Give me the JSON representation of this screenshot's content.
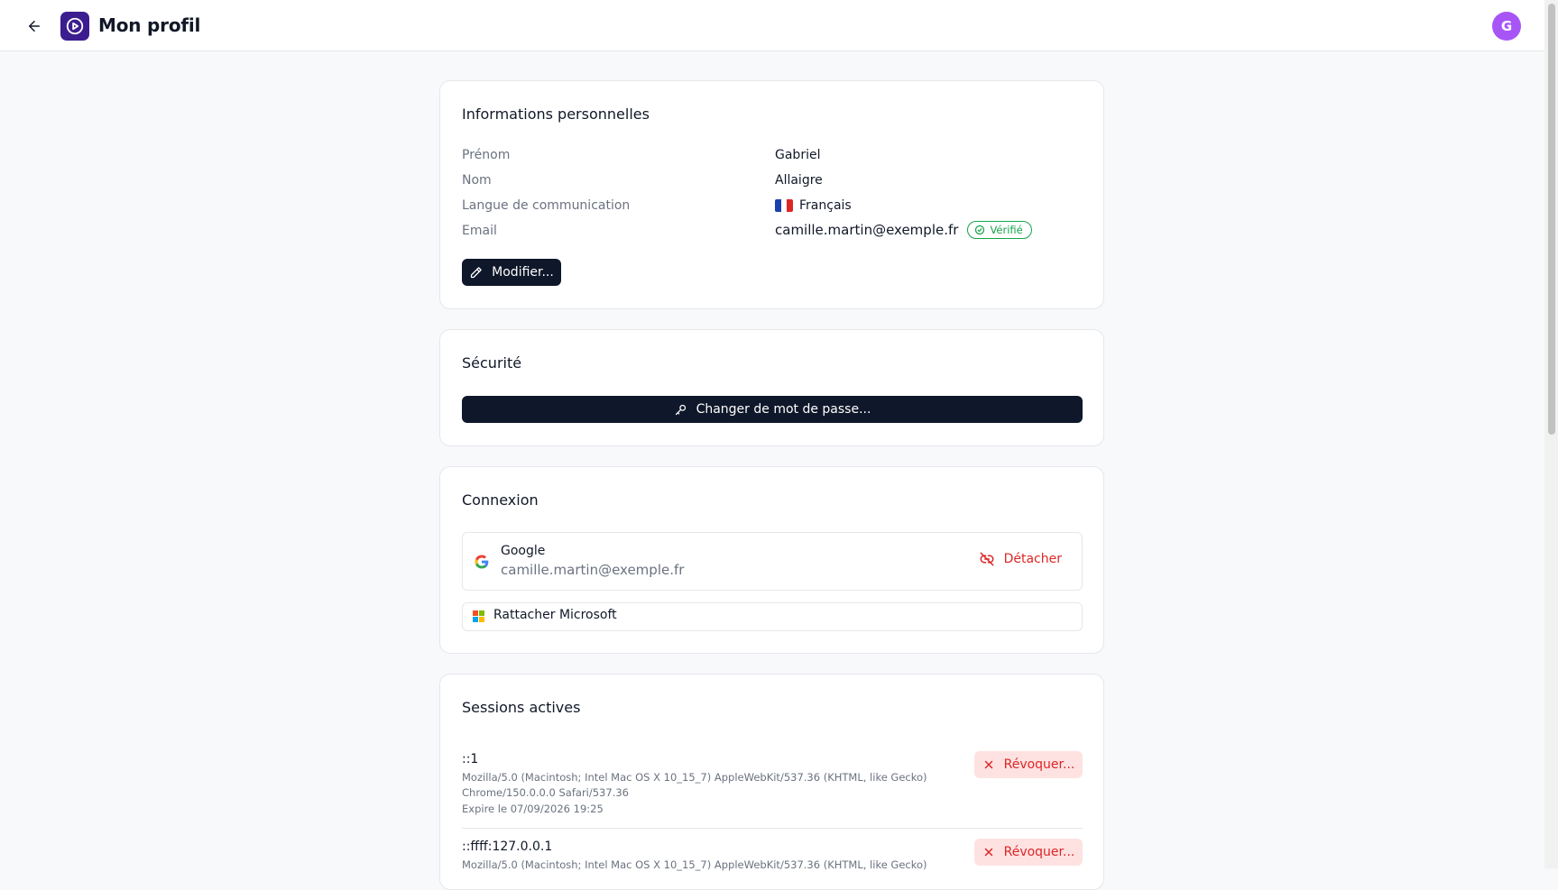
{
  "header": {
    "title": "Mon profil",
    "avatar_initial": "G",
    "back_icon": "arrow-left-icon",
    "logo_icon": "play-circle-icon",
    "logo_color": "#3b1d8f",
    "avatar_color": "#a855f7"
  },
  "personal": {
    "title": "Informations personnelles",
    "fields": [
      {
        "label": "Prénom",
        "value": "Gabriel"
      },
      {
        "label": "Nom",
        "value": "Allaigre"
      },
      {
        "label": "Langue de communication",
        "value": "Français"
      },
      {
        "label": "Email",
        "value": "camille.martin@exemple.fr"
      }
    ],
    "verified_label": "Vérifié",
    "edit_label": "Modifier..."
  },
  "security": {
    "title": "Sécurité",
    "change_password_label": "Changer de mot de passe..."
  },
  "connection": {
    "title": "Connexion",
    "google": {
      "name": "Google",
      "email": "camille.martin@exemple.fr",
      "detach_label": "Détacher"
    },
    "microsoft": {
      "label": "Rattacher Microsoft"
    }
  },
  "sessions": {
    "title": "Sessions actives",
    "items": [
      {
        "ip": "::1",
        "user_agent": "Mozilla/5.0 (Macintosh; Intel Mac OS X 10_15_7) AppleWebKit/537.36 (KHTML, like Gecko) Chrome/150.0.0.0 Safari/537.36",
        "expires": "Expire le 07/09/2026 19:25",
        "revoke_label": "Révoquer..."
      },
      {
        "ip": "::ffff:127.0.0.1",
        "user_agent": "Mozilla/5.0 (Macintosh; Intel Mac OS X 10_15_7) AppleWebKit/537.36 (KHTML, like Gecko)",
        "revoke_label": "Révoquer..."
      }
    ]
  },
  "colors": {
    "primary_dark": "#0f172a",
    "danger": "#dc2626",
    "success": "#16a34a"
  }
}
